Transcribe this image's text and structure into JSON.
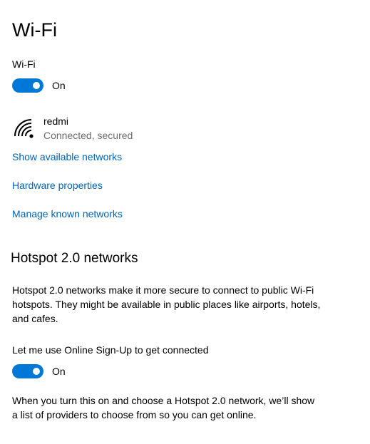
{
  "page": {
    "title": "Wi-Fi"
  },
  "wifi": {
    "label": "Wi-Fi",
    "toggle_on": true,
    "toggle_state": "On"
  },
  "network": {
    "icon": "wifi-signal-icon",
    "name": "redmi",
    "status": "Connected, secured"
  },
  "links": {
    "show_available": "Show available networks",
    "hardware_properties": "Hardware properties",
    "manage_known": "Manage known networks"
  },
  "hotspot": {
    "title": "Hotspot 2.0 networks",
    "description": "Hotspot 2.0 networks make it more secure to connect to public Wi-Fi hotspots. They might be available in public places like airports, hotels, and cafes.",
    "signup_label": "Let me use Online Sign-Up to get connected",
    "signup_toggle_on": true,
    "signup_toggle_state": "On",
    "signup_description": "When you turn this on and choose a Hotspot 2.0 network, we’ll show a list of providers to choose from so you can get online."
  },
  "colors": {
    "accent": "#0078d7",
    "link": "#0063b1",
    "secondary_text": "#6b6b6b"
  }
}
